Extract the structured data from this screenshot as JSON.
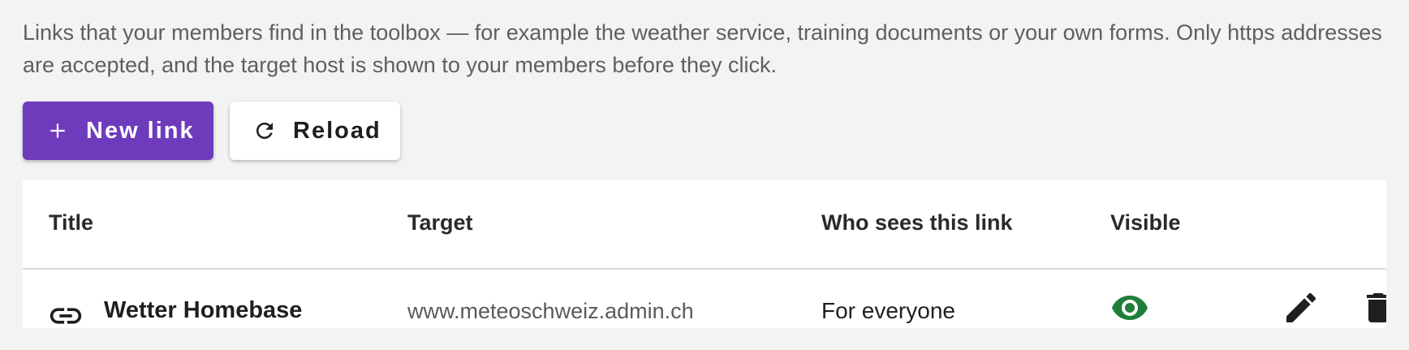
{
  "description": "Links that your members find in the toolbox — for example the weather service, training documents or your own forms. Only https addresses are accepted, and the target host is shown to your members before they click.",
  "toolbar": {
    "new_link_label": "New link",
    "new_link_icon": "plus-icon",
    "reload_label": "Reload",
    "reload_icon": "refresh-icon"
  },
  "colors": {
    "primary": "#6f3bbd",
    "visible_green": "#1f7f3a",
    "background": "#f3f3f3"
  },
  "table": {
    "columns": [
      "Title",
      "Target",
      "Who sees this link",
      "Visible"
    ],
    "rows": [
      {
        "icon": "link-icon",
        "title": "Wetter Homebase",
        "target": "www.meteoschweiz.admin.ch",
        "audience": "For everyone",
        "visible": true,
        "visible_icon": "eye-icon",
        "actions": [
          "edit-icon",
          "delete-icon"
        ]
      }
    ]
  }
}
